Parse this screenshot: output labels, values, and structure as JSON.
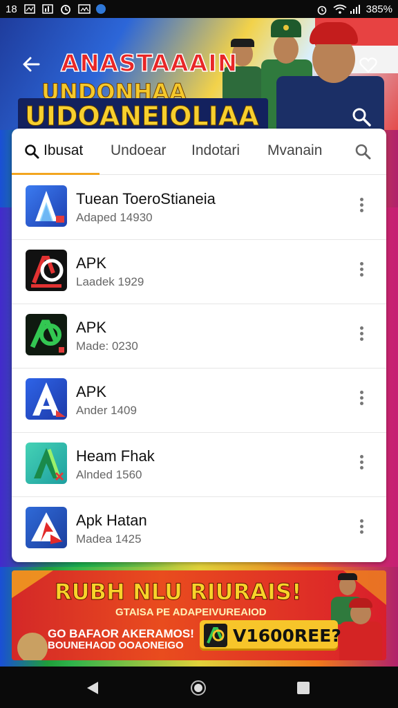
{
  "status_bar": {
    "time": "18",
    "battery": "385%"
  },
  "banner": {
    "title_line_1": "ANASTAAAIN",
    "title_line_2": "UNDONHAA",
    "title_line_3": "UIDOANEIOLIAA"
  },
  "tabs": [
    {
      "label": "Ibusat"
    },
    {
      "label": "Undoear"
    },
    {
      "label": "Indotari"
    },
    {
      "label": "Mvanain"
    }
  ],
  "apps": [
    {
      "title": "Tuean ToeroStianeia",
      "sub": "Adaped 14930",
      "icon_color": "#2b6fe3"
    },
    {
      "title": "APK",
      "sub": "Laadek 1929",
      "icon_color": "#111111"
    },
    {
      "title": "APK",
      "sub": "Made: 0230",
      "icon_color": "#0f1a10"
    },
    {
      "title": "APK",
      "sub": "Ander 1409",
      "icon_color": "#2856d6"
    },
    {
      "title": "Heam Fhak",
      "sub": "Alnded 1560",
      "icon_color": "#2ec4a6"
    },
    {
      "title": "Apk Hatan",
      "sub": "Madea 1425",
      "icon_color": "#2457c8"
    }
  ],
  "promo": {
    "title": "RUBH NLU RIURAIS!",
    "sub": "GTAISA PE ADAPEIVUREAIOD",
    "small_1": "GO BAFAOR AKERAMOS!",
    "small_2": "BOUNEHAOD OOAONEIGO",
    "button_label": "V1600REE?"
  }
}
